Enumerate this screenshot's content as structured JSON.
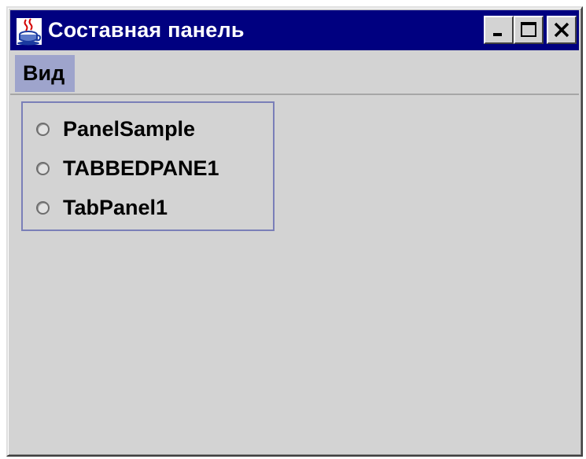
{
  "window": {
    "title": "Составная панель",
    "icon": "java-coffee-cup-icon",
    "controls": {
      "minimize": "minimize-icon",
      "maximize": "maximize-icon",
      "close": "close-icon"
    }
  },
  "menubar": {
    "items": [
      {
        "label": "Вид",
        "active": true
      }
    ]
  },
  "popup": {
    "items": [
      {
        "label": "PanelSample",
        "selected": false
      },
      {
        "label": "TABBEDPANE1",
        "selected": false
      },
      {
        "label": "TabPanel1",
        "selected": false
      }
    ]
  },
  "colors": {
    "titlebar": "#000080",
    "menu_highlight": "#9ea4cc",
    "background": "#d3d3d3",
    "popup_border": "#7a7fb8"
  }
}
